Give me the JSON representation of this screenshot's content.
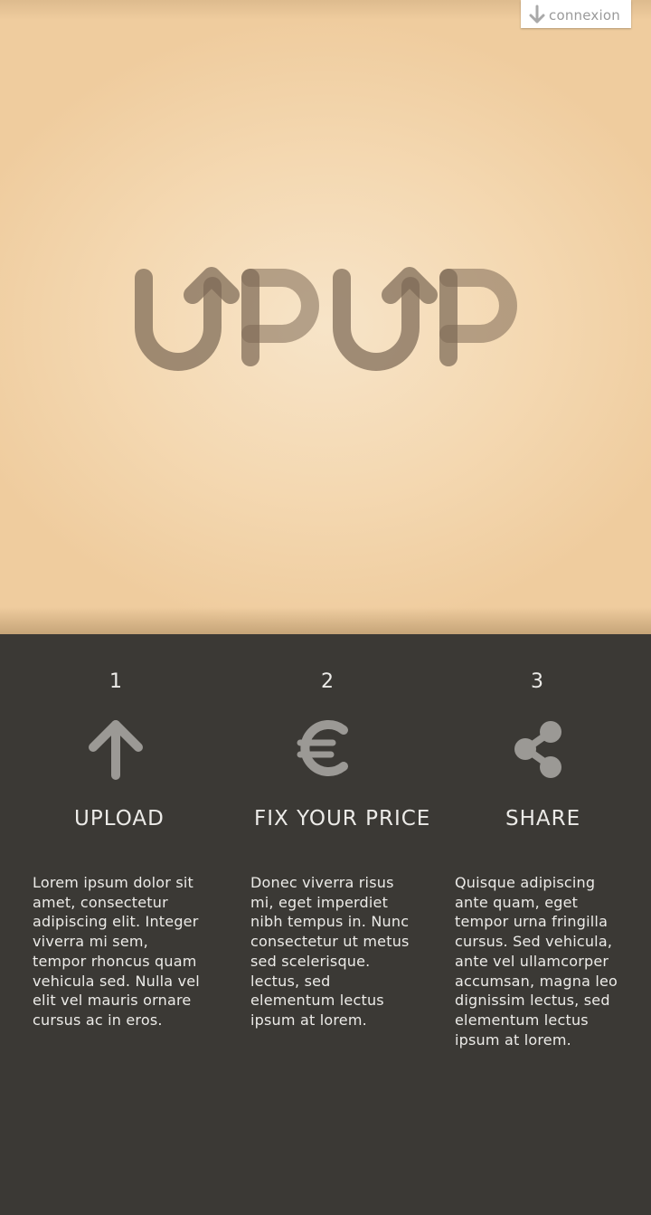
{
  "header": {
    "connexion_label": "connexion",
    "connexion_icon": "arrow-down-icon"
  },
  "hero": {
    "logo_text": "UPUP",
    "logo_icon": "upup-logo"
  },
  "steps": [
    {
      "number": "1",
      "icon": "arrow-up-icon",
      "title": "UPLOAD",
      "text": "Lorem ipsum dolor sit amet, consectetur adipiscing elit. Integer viverra mi sem, tempor rhoncus quam vehicula sed. Nulla vel elit vel mauris ornare cursus ac in eros."
    },
    {
      "number": "2",
      "icon": "euro-icon",
      "title": "FIX YOUR PRICE",
      "text": "Donec viverra risus mi, eget imperdiet nibh tempus in. Nunc consectetur ut metus sed scelerisque. lectus, sed elementum lectus ipsum at lorem."
    },
    {
      "number": "3",
      "icon": "share-icon",
      "title": "SHARE",
      "text": "Quisque adipiscing ante quam, eget tempor urna fringilla cursus. Sed vehicula, ante vel ullamcorper accumsan, magna leo dignissim lectus, sed elementum lectus ipsum at lorem."
    }
  ],
  "colors": {
    "hero_background": "#f4d8b1",
    "logo": "#8a7763",
    "footer_background": "#3b3935",
    "icon_gray": "#9b9995",
    "text_light": "#ecebe8"
  }
}
